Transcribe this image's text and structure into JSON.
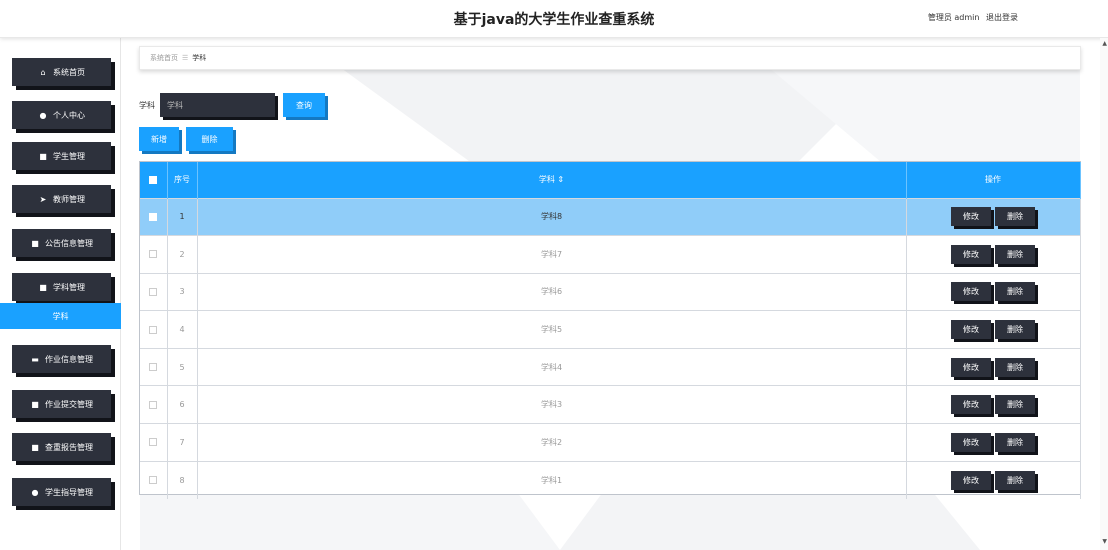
{
  "header": {
    "title": "基于java的大学生作业查重系统",
    "user_label": "管理员 admin",
    "logout_label": "退出登录"
  },
  "sidebar": {
    "items": [
      {
        "label": "系统首页",
        "icon": "home-icon"
      },
      {
        "label": "个人中心",
        "icon": "user-icon"
      },
      {
        "label": "学生管理",
        "icon": "grid-icon"
      },
      {
        "label": "教师管理",
        "icon": "send-icon"
      },
      {
        "label": "公告信息管理",
        "icon": "grid-icon"
      },
      {
        "label": "学科管理",
        "icon": "grid-icon"
      },
      {
        "label": "作业信息管理",
        "icon": "monitor-icon"
      },
      {
        "label": "作业提交管理",
        "icon": "grid-icon"
      },
      {
        "label": "查重报告管理",
        "icon": "grid-icon"
      },
      {
        "label": "学生指导管理",
        "icon": "user-icon"
      }
    ],
    "active_sub_item": "学科"
  },
  "breadcrumb": {
    "home": "系统首页",
    "current": "学科"
  },
  "search": {
    "label": "学科",
    "placeholder": "学科",
    "button": "查询"
  },
  "actions": {
    "add": "新增",
    "delete": "删除"
  },
  "table": {
    "columns": {
      "index": "序号",
      "subject": "学科 ⇕",
      "ops": "操作"
    },
    "edit_label": "修改",
    "delete_label": "删除",
    "rows": [
      {
        "index": "1",
        "subject": "学科8"
      },
      {
        "index": "2",
        "subject": "学科7"
      },
      {
        "index": "3",
        "subject": "学科6"
      },
      {
        "index": "4",
        "subject": "学科5"
      },
      {
        "index": "5",
        "subject": "学科4"
      },
      {
        "index": "6",
        "subject": "学科3"
      },
      {
        "index": "7",
        "subject": "学科2"
      },
      {
        "index": "8",
        "subject": "学科1"
      }
    ]
  },
  "colors": {
    "accent": "#1aa1ff",
    "dark_button": "#2d313c",
    "selected_row": "#90cdf9"
  }
}
